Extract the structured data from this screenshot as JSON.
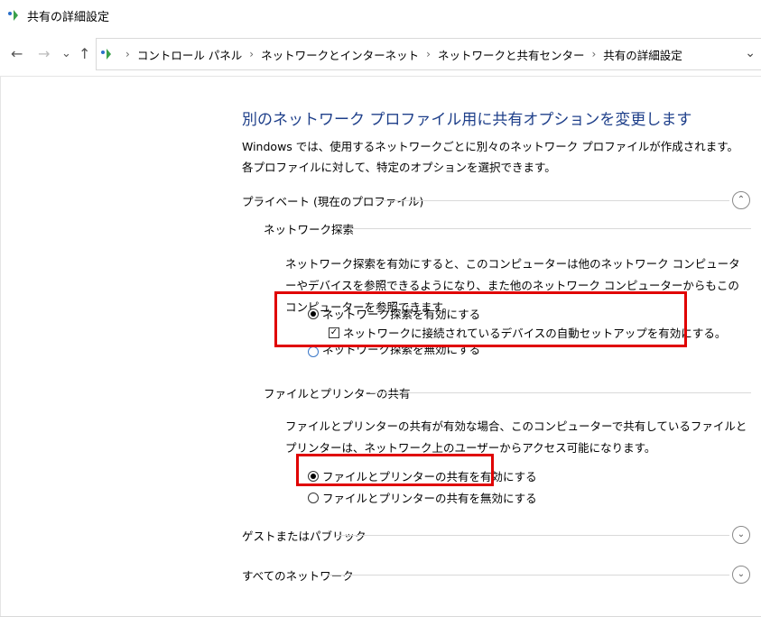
{
  "window": {
    "title": "共有の詳細設定",
    "icon": "network-icon"
  },
  "nav": {
    "back": "←",
    "forward": "→",
    "recent": "⌄",
    "up": "↑"
  },
  "breadcrumb": {
    "items": [
      "コントロール パネル",
      "ネットワークとインターネット",
      "ネットワークと共有センター",
      "共有の詳細設定"
    ],
    "separator": "›",
    "dropdown": "⌄"
  },
  "main": {
    "heading": "別のネットワーク プロファイル用に共有オプションを変更します",
    "description": "Windows では、使用するネットワークごとに別々のネットワーク プロファイルが作成されます。各プロファイルに対して、特定のオプションを選択できます。"
  },
  "private": {
    "label": "プライベート (現在のプロファイル)",
    "toggle": "⌃",
    "network_discovery": {
      "label": "ネットワーク探索",
      "description": "ネットワーク探索を有効にすると、このコンピューターは他のネットワーク コンピューターやデバイスを参照できるようになり、また他のネットワーク コンピューターからもこのコンピューターを参照できます。",
      "enable_label": "ネットワーク探索を有効にする",
      "enable_selected": true,
      "auto_setup_label": "ネットワークに接続されているデバイスの自動セットアップを有効にする。",
      "auto_setup_checked": true,
      "checkmark": "✓",
      "disable_label": "ネットワーク探索を無効にする"
    },
    "file_printer_sharing": {
      "label": "ファイルとプリンターの共有",
      "description": "ファイルとプリンターの共有が有効な場合、このコンピューターで共有しているファイルとプリンターは、ネットワーク上のユーザーからアクセス可能になります。",
      "enable_label": "ファイルとプリンターの共有を有効にする",
      "enable_selected": true,
      "disable_label": "ファイルとプリンターの共有を無効にする"
    }
  },
  "guest_public": {
    "label": "ゲストまたはパブリック",
    "toggle": "⌄"
  },
  "all_networks": {
    "label": "すべてのネットワーク",
    "toggle": "⌄"
  },
  "colors": {
    "heading": "#1e3f8a",
    "highlight": "#e00000",
    "radio_unselected": "#3a78c8"
  }
}
